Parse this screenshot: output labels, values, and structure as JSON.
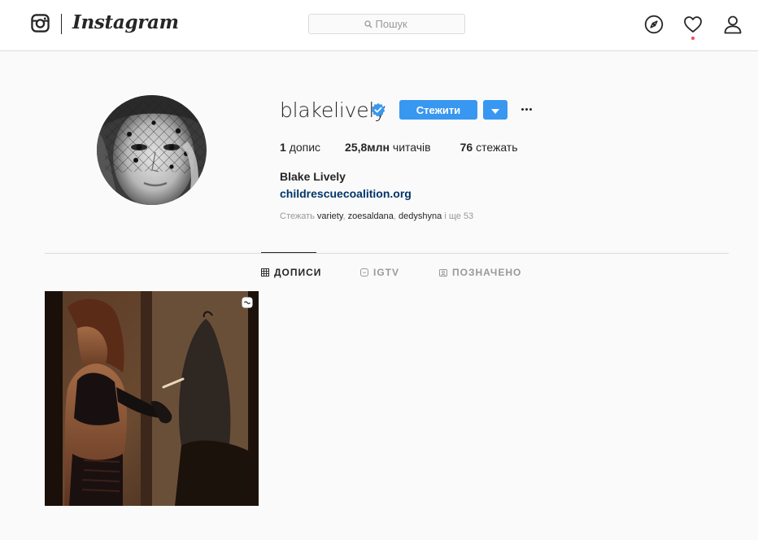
{
  "header": {
    "wordmark": "Instagram",
    "search_placeholder": "Пошук",
    "icons": [
      "instagram-camera-icon",
      "search-icon",
      "explore-compass-icon",
      "activity-heart-icon",
      "profile-person-icon"
    ]
  },
  "profile": {
    "username": "blakelively",
    "verified": true,
    "follow_label": "Стежити",
    "stats": [
      {
        "count": "1",
        "label": "допис"
      },
      {
        "count": "25,8млн",
        "label": "читачів"
      },
      {
        "count": "76",
        "label": "стежать"
      }
    ],
    "full_name": "Blake Lively",
    "website": "childrescuecoalition.org",
    "followed_by": {
      "prefix": "Стежать",
      "users": [
        "variety",
        "zoesaldana",
        "dedyshyna"
      ],
      "suffix": "і ще 53"
    }
  },
  "tabs": [
    {
      "label": "ДОПИСИ",
      "icon": "grid-icon",
      "active": true
    },
    {
      "label": "IGTV",
      "icon": "igtv-icon",
      "active": false
    },
    {
      "label": "ПОЗНАЧЕНО",
      "icon": "tagged-icon",
      "active": false
    }
  ],
  "posts": [
    {
      "type": "video",
      "badge_icon": "video-badge-icon"
    }
  ],
  "colors": {
    "accent": "#3897f0",
    "link": "#003569",
    "notification": "#ed4956",
    "verified": "#3897f0"
  }
}
